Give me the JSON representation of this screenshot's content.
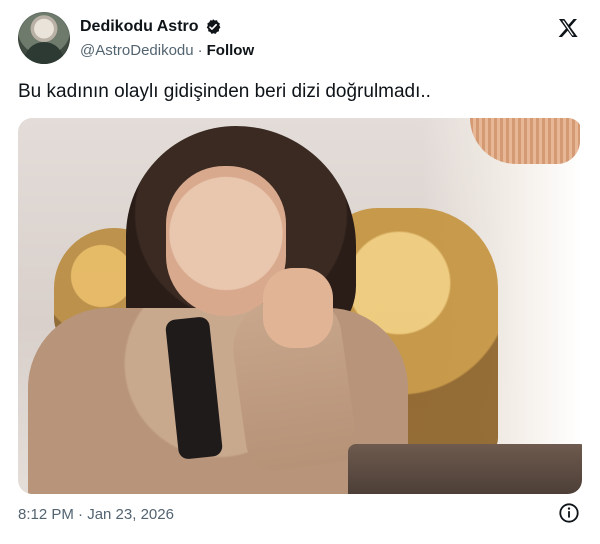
{
  "account": {
    "display_name": "Dedikodu Astro",
    "handle": "@AstroDedikodu",
    "separator": "·",
    "follow_label": "Follow",
    "verified_icon": "verified-badge-icon"
  },
  "brand": {
    "icon": "x-logo-icon"
  },
  "tweet": {
    "text": "Bu kadının olaylı gidişinden beri dizi doğrulmadı..",
    "media": {
      "type": "photo"
    }
  },
  "meta": {
    "timestamp": "8:12 PM · Jan 23, 2026",
    "info_icon": "info-icon"
  },
  "colors": {
    "text_primary": "#0f1419",
    "text_secondary": "#536471",
    "background": "#ffffff"
  }
}
